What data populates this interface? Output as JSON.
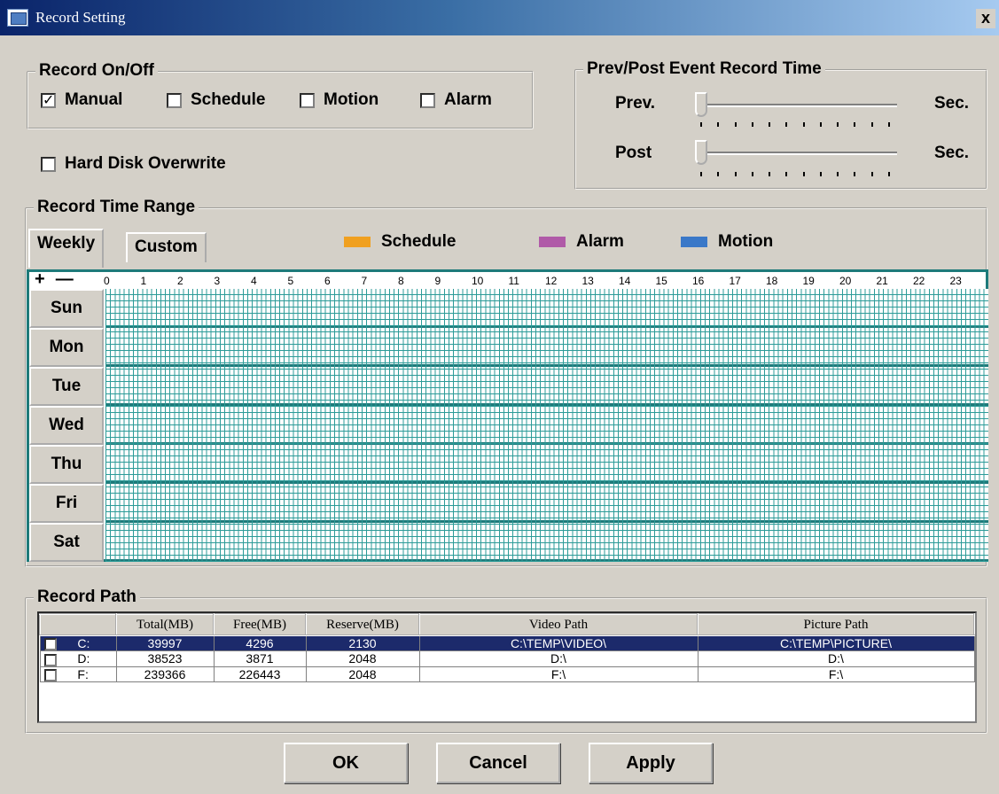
{
  "window": {
    "title": "Record Setting",
    "close": "x"
  },
  "record_onoff": {
    "legend": "Record On/Off",
    "options": [
      {
        "label": "Manual",
        "checked": true
      },
      {
        "label": "Schedule",
        "checked": false
      },
      {
        "label": "Motion",
        "checked": false
      },
      {
        "label": "Alarm",
        "checked": false
      }
    ]
  },
  "hard_disk_overwrite": {
    "label": "Hard Disk Overwrite",
    "checked": false
  },
  "event_time": {
    "legend": "Prev/Post Event Record Time",
    "prev_label": "Prev.",
    "post_label": "Post",
    "unit": "Sec."
  },
  "time_range": {
    "legend": "Record Time Range",
    "tabs": [
      "Weekly",
      "Custom"
    ],
    "legend_items": [
      {
        "label": "Schedule",
        "color": "#f0a020"
      },
      {
        "label": "Alarm",
        "color": "#b05aa8"
      },
      {
        "label": "Motion",
        "color": "#3a78c8"
      }
    ],
    "plus": "+",
    "minus": "—",
    "hours": [
      "0",
      "1",
      "2",
      "3",
      "4",
      "5",
      "6",
      "7",
      "8",
      "9",
      "10",
      "11",
      "12",
      "13",
      "14",
      "15",
      "16",
      "17",
      "18",
      "19",
      "20",
      "21",
      "22",
      "23"
    ],
    "days": [
      "Sun",
      "Mon",
      "Tue",
      "Wed",
      "Thu",
      "Fri",
      "Sat"
    ]
  },
  "record_path": {
    "legend": "Record Path",
    "columns": [
      "",
      "Total(MB)",
      "Free(MB)",
      "Reserve(MB)",
      "Video Path",
      "Picture Path"
    ],
    "rows": [
      {
        "checked": true,
        "drive": "C:",
        "total": "39997",
        "free": "4296",
        "reserve": "2130",
        "video": "C:\\TEMP\\VIDEO\\",
        "picture": "C:\\TEMP\\PICTURE\\"
      },
      {
        "checked": false,
        "drive": "D:",
        "total": "38523",
        "free": "3871",
        "reserve": "2048",
        "video": "D:\\",
        "picture": "D:\\"
      },
      {
        "checked": false,
        "drive": "F:",
        "total": "239366",
        "free": "226443",
        "reserve": "2048",
        "video": "F:\\",
        "picture": "F:\\"
      }
    ]
  },
  "buttons": {
    "ok": "OK",
    "cancel": "Cancel",
    "apply": "Apply"
  }
}
